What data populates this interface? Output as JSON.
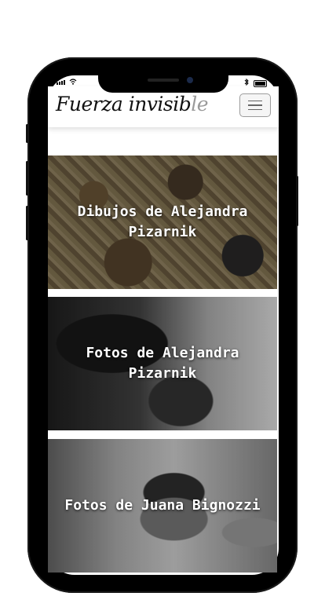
{
  "header": {
    "brand_main": "Fuerza invisib",
    "brand_fade": "le"
  },
  "cards": [
    {
      "title": "Dibujos de Alejandra Pizarnik"
    },
    {
      "title": "Fotos de Alejandra Pizarnik"
    },
    {
      "title": "Fotos de Juana Bignozzi"
    }
  ]
}
